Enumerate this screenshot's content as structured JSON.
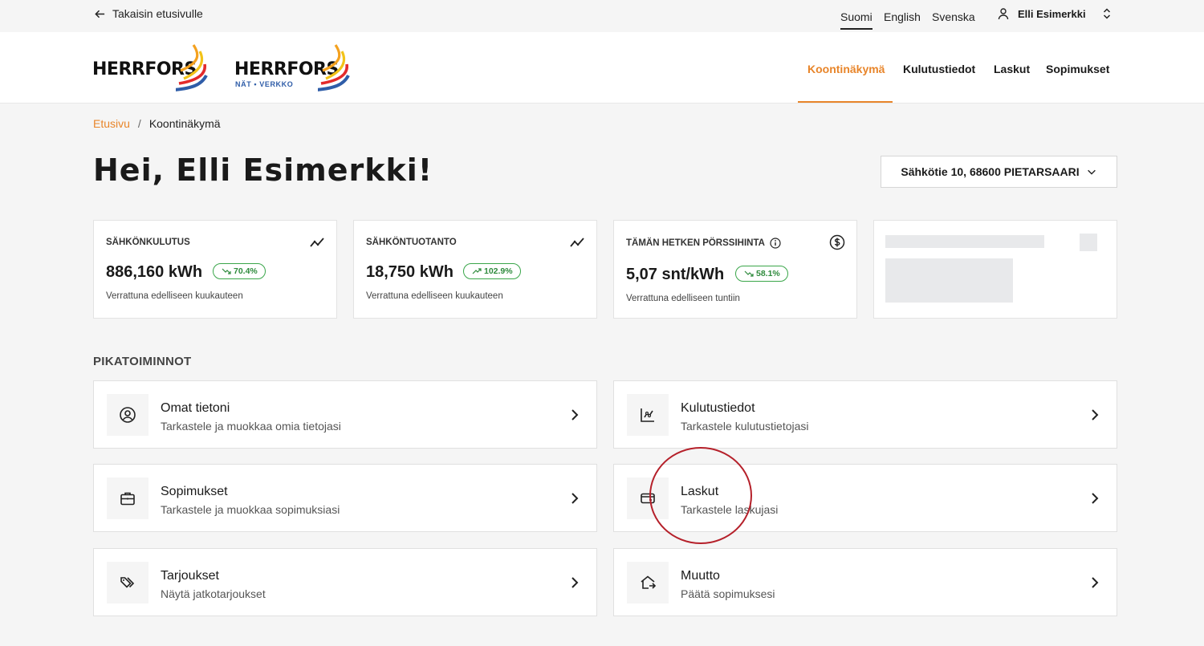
{
  "topbar": {
    "back_label": "Takaisin etusivulle",
    "languages": [
      "Suomi",
      "English",
      "Svenska"
    ],
    "active_language": "Suomi",
    "user_name": "Elli Esimerkki"
  },
  "header": {
    "logos": [
      {
        "text": "HERRFORS",
        "sub": ""
      },
      {
        "text": "HERRFORS",
        "sub": "NÄT • VERKKO"
      }
    ],
    "nav": [
      "Koontinäkymä",
      "Kulutustiedot",
      "Laskut",
      "Sopimukset"
    ],
    "active_nav": "Koontinäkymä"
  },
  "breadcrumb": {
    "home": "Etusivu",
    "separator": "/",
    "current": "Koontinäkymä"
  },
  "page_title": "Hei, Elli Esimerkki!",
  "address": "Sähkötie 10, 68600 PIETARSAARI",
  "stats": [
    {
      "label": "SÄHKÖNKULUTUS",
      "value": "886,160 kWh",
      "change": "70.4%",
      "trend": "down",
      "note": "Verrattuna edelliseen kuukauteen",
      "icon": "trend-line-icon"
    },
    {
      "label": "SÄHKÖNTUOTANTO",
      "value": "18,750 kWh",
      "change": "102.9%",
      "trend": "up",
      "note": "Verrattuna edelliseen kuukauteen",
      "icon": "trend-line-icon"
    },
    {
      "label": "TÄMÄN HETKEN PÖRSSIHINTA",
      "value": "5,07 snt/kWh",
      "change": "58.1%",
      "trend": "down",
      "note": "Verrattuna edelliseen tuntiin",
      "icon": "dollar-circle-icon"
    }
  ],
  "quick_actions_title": "PIKATOIMINNOT",
  "quick_actions": [
    {
      "title": "Omat tietoni",
      "subtitle": "Tarkastele ja muokkaa omia tietojasi",
      "icon": "user-circle-icon"
    },
    {
      "title": "Kulutustiedot",
      "subtitle": "Tarkastele kulutustietojasi",
      "icon": "chart-icon"
    },
    {
      "title": "Sopimukset",
      "subtitle": "Tarkastele ja muokkaa sopimuksiasi",
      "icon": "briefcase-icon"
    },
    {
      "title": "Laskut",
      "subtitle": "Tarkastele laskujasi",
      "icon": "credit-card-icon"
    },
    {
      "title": "Tarjoukset",
      "subtitle": "Näytä jatkotarjoukset",
      "icon": "tags-icon"
    },
    {
      "title": "Muutto",
      "subtitle": "Päätä sopimuksesi",
      "icon": "house-move-icon"
    }
  ],
  "colors": {
    "accent": "#e8852a",
    "positive": "#2e8a3c",
    "highlight": "#b5202a"
  }
}
